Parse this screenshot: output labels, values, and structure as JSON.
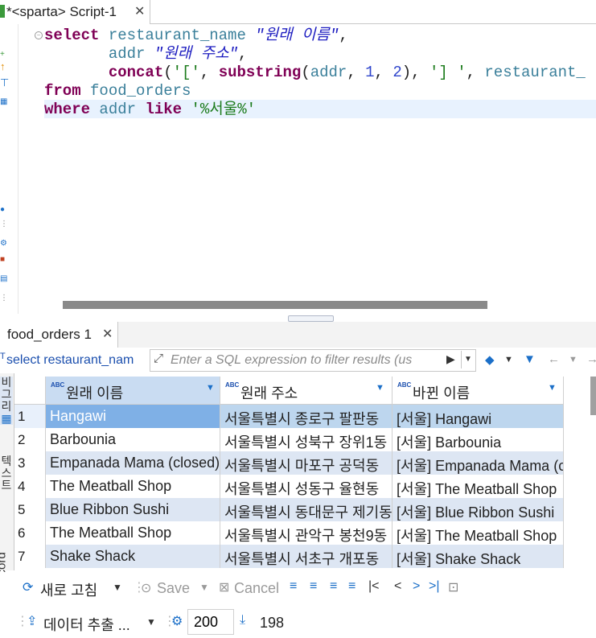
{
  "editor_tab": {
    "title": "*<sparta> Script-1",
    "close": "✕"
  },
  "code": {
    "line1": {
      "kw": "select",
      "id": "restaurant_name",
      "alias": "\"원래 이름\"",
      "tail": ","
    },
    "line2": {
      "id": "addr",
      "alias": "\"원래 주소\"",
      "tail": ","
    },
    "line3": {
      "fn": "concat",
      "open": "(",
      "s1": "'['",
      "c1": ", ",
      "fn2": "substring",
      "args_open": "(",
      "arg1": "addr",
      "c2": ", ",
      "n1": "1",
      "c3": ", ",
      "n2": "2",
      "args_close": ")",
      "c4": ", ",
      "s2": "'] '",
      "c5": ", ",
      "tail_id": "restaurant_"
    },
    "line4": {
      "kw": "from",
      "id": "food_orders"
    },
    "line5": {
      "kw": "where",
      "id": "addr",
      "kw2": "like",
      "str": "'%서울%'"
    }
  },
  "results_tab": {
    "title": "food_orders 1",
    "close": "✕"
  },
  "filter": {
    "query_label": "select restaurant_nam",
    "placeholder": "Enter a SQL expression to filter results (us"
  },
  "side_panel": {
    "seg1": "비\n그\n리\n드",
    "seg2": "텍\n스\n트"
  },
  "record_label": "Record",
  "grid": {
    "columns": [
      {
        "label": "원래 이름"
      },
      {
        "label": "원래 주소"
      },
      {
        "label": "바뀐 이름"
      }
    ],
    "rows": [
      {
        "n": "1",
        "name": "Hangawi",
        "addr": "서울특별시 종로구 팔판동",
        "new": "[서울] Hangawi"
      },
      {
        "n": "2",
        "name": "Barbounia",
        "addr": "서울특별시 성북구 장위1동",
        "new": "[서울] Barbounia"
      },
      {
        "n": "3",
        "name": "Empanada Mama (closed)",
        "addr": "서울특별시 마포구 공덕동",
        "new": "[서울] Empanada Mama (closed)"
      },
      {
        "n": "4",
        "name": "The Meatball Shop",
        "addr": "서울특별시 성동구 율현동",
        "new": "[서울] The Meatball Shop"
      },
      {
        "n": "5",
        "name": "Blue Ribbon Sushi",
        "addr": "서울특별시 동대문구 제기동",
        "new": "[서울] Blue Ribbon Sushi"
      },
      {
        "n": "6",
        "name": "The Meatball Shop",
        "addr": "서울특별시 관악구 봉천9동",
        "new": "[서울] The Meatball Shop"
      },
      {
        "n": "7",
        "name": "Shake Shack",
        "addr": "서울특별시 서초구 개포동",
        "new": "[서울] Shake Shack"
      }
    ]
  },
  "toolbar": {
    "refresh": "새로 고침",
    "save": "Save",
    "cancel": "Cancel",
    "export": "데이터 추출 ...",
    "fetch_size": "200",
    "row_count": "198"
  },
  "colors": {
    "keyword": "#7f0055",
    "identifier": "#3a7f9a",
    "string": "#1a7a1a",
    "selected_row": "#bdd6ee",
    "zebra": "#dde6f3"
  }
}
